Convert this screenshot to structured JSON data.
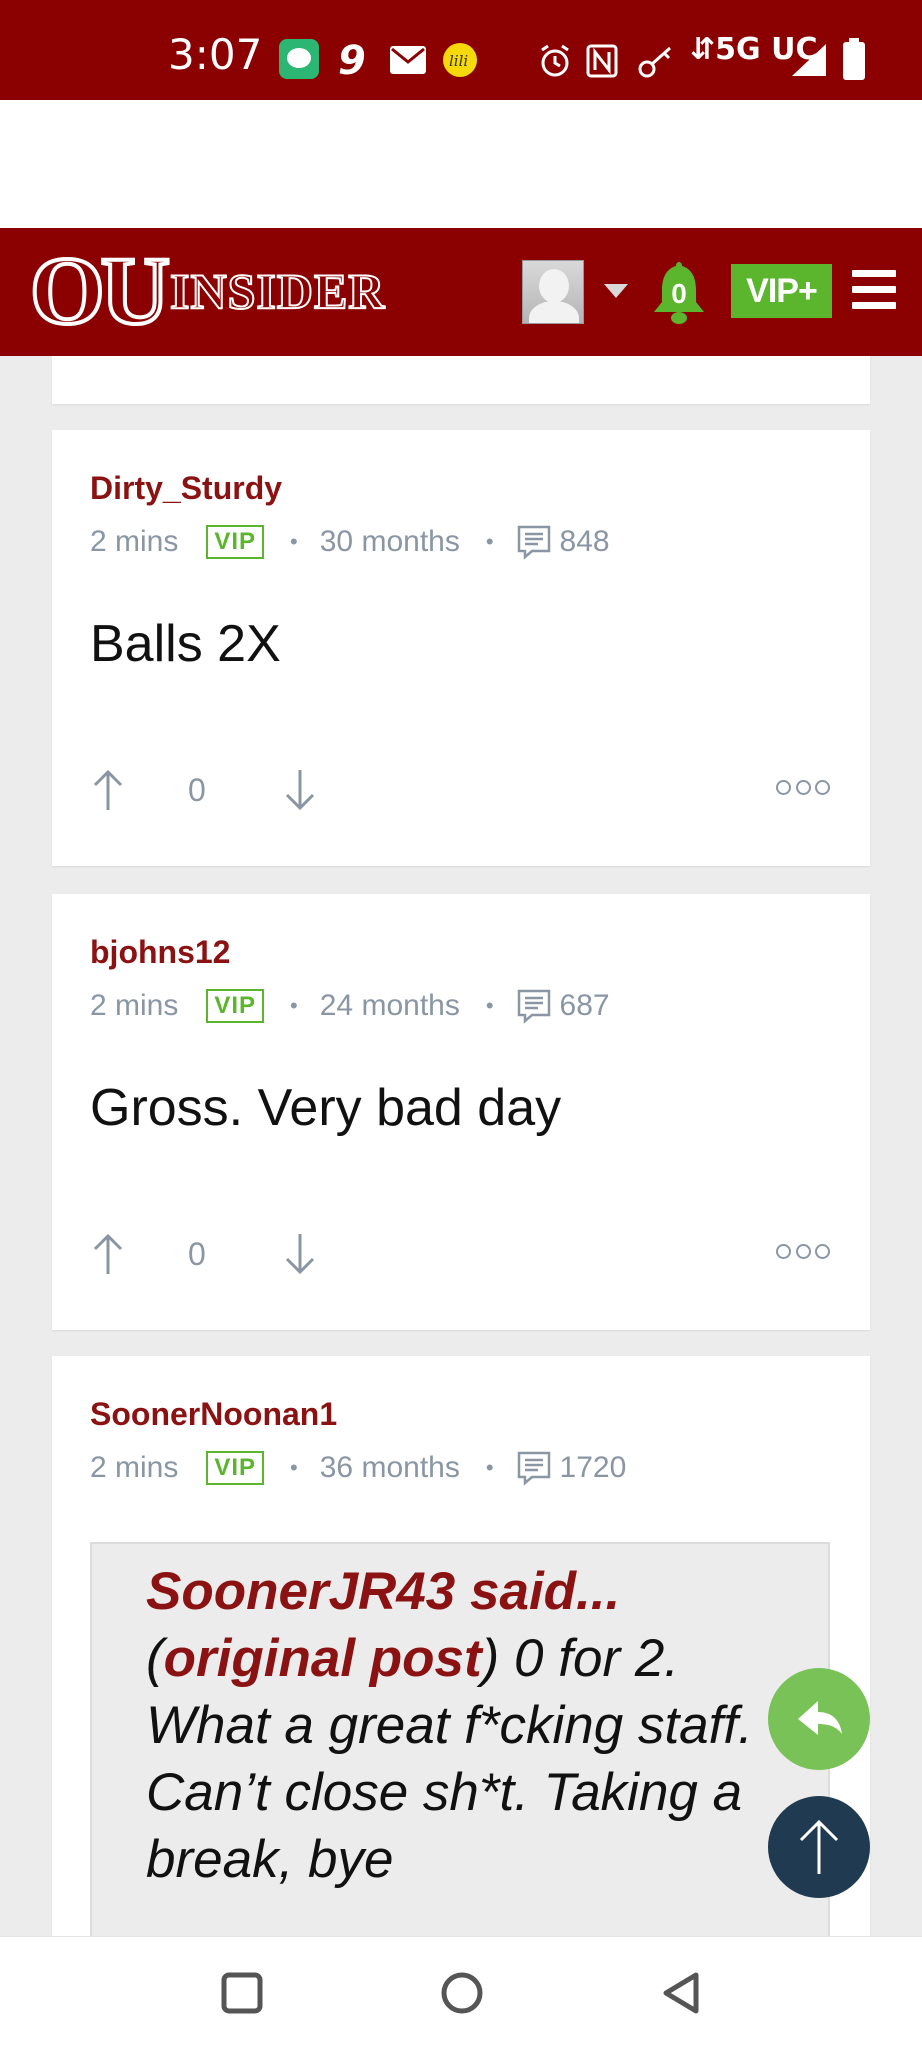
{
  "status_bar": {
    "time": "3:07",
    "network": "5G UC",
    "icons": [
      "messages-icon",
      "nine-icon",
      "gmail-icon",
      "lili-icon",
      "alarm-icon",
      "nfc-icon",
      "key-icon",
      "signal-icon",
      "battery-icon"
    ]
  },
  "site_header": {
    "logo_ou": "OU",
    "logo_insider": "INSIDER",
    "notification_count": "0",
    "vip_button": "VIP+",
    "colors": {
      "brand": "#8b0000",
      "accent": "#5bb52d"
    }
  },
  "posts": [
    {
      "username": "Dirty_Sturdy",
      "time": "2 mins",
      "badge": "VIP",
      "tenure": "30 months",
      "post_count": "848",
      "body": "Balls 2X",
      "votes": "0"
    },
    {
      "username": "bjohns12",
      "time": "2 mins",
      "badge": "VIP",
      "tenure": "24 months",
      "post_count": "687",
      "body": "Gross. Very bad day",
      "votes": "0"
    },
    {
      "username": "SoonerNoonan1",
      "time": "2 mins",
      "badge": "VIP",
      "tenure": "36 months",
      "post_count": "1720",
      "quote": {
        "author": "SoonerJR43 said...",
        "link": "original post",
        "text": " 0 for 2. What a great f*cking staff. Can’t close sh*t. Taking a break, bye"
      }
    }
  ]
}
